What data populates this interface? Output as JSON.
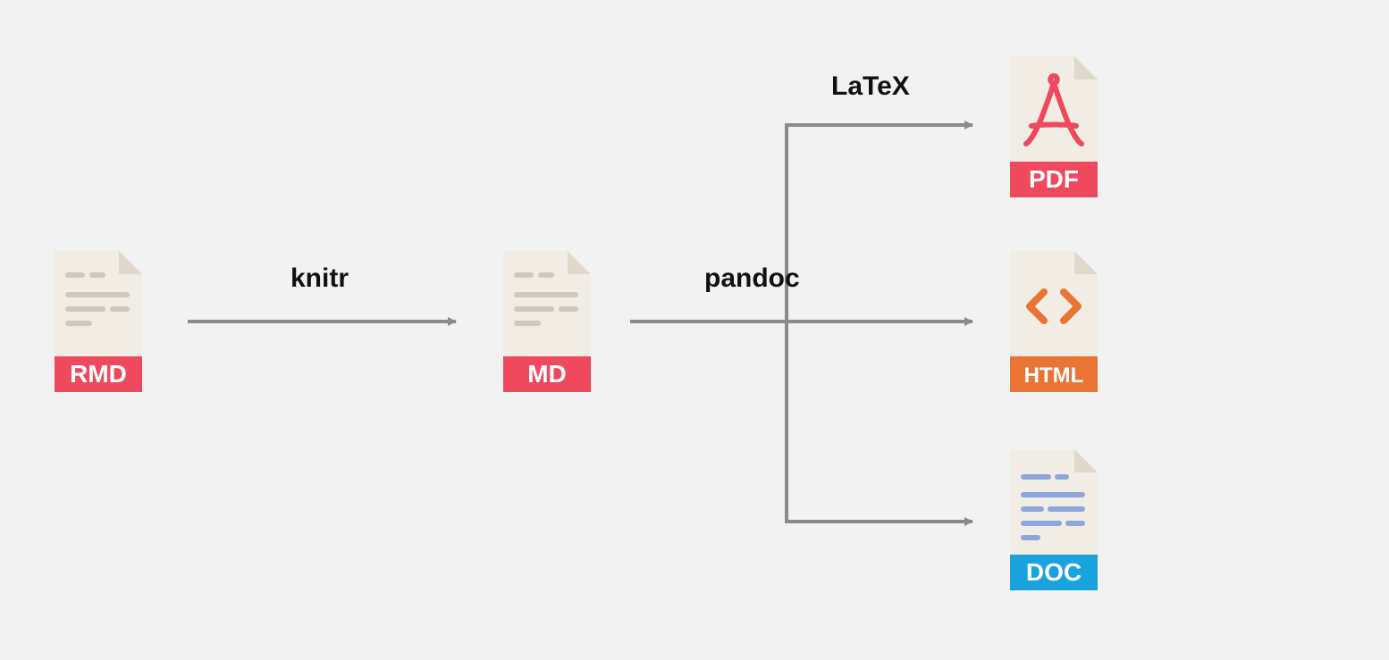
{
  "files": {
    "rmd": {
      "badge": "RMD",
      "badge_color": "#ef495e"
    },
    "md": {
      "badge": "MD",
      "badge_color": "#ef495e"
    },
    "pdf": {
      "badge": "PDF",
      "badge_color": "#ef495e"
    },
    "html": {
      "badge": "HTML",
      "badge_color": "#e97433"
    },
    "doc": {
      "badge": "DOC",
      "badge_color": "#18a2de"
    }
  },
  "labels": {
    "knitr": "knitr",
    "pandoc": "pandoc",
    "latex": "LaTeX"
  },
  "diagram": {
    "flow": [
      {
        "from": "RMD",
        "via": "knitr",
        "to": "MD"
      },
      {
        "from": "MD",
        "via": "pandoc",
        "branches": [
          {
            "label": "LaTeX",
            "to": "PDF"
          },
          {
            "to": "HTML"
          },
          {
            "to": "DOC"
          }
        ]
      }
    ]
  }
}
